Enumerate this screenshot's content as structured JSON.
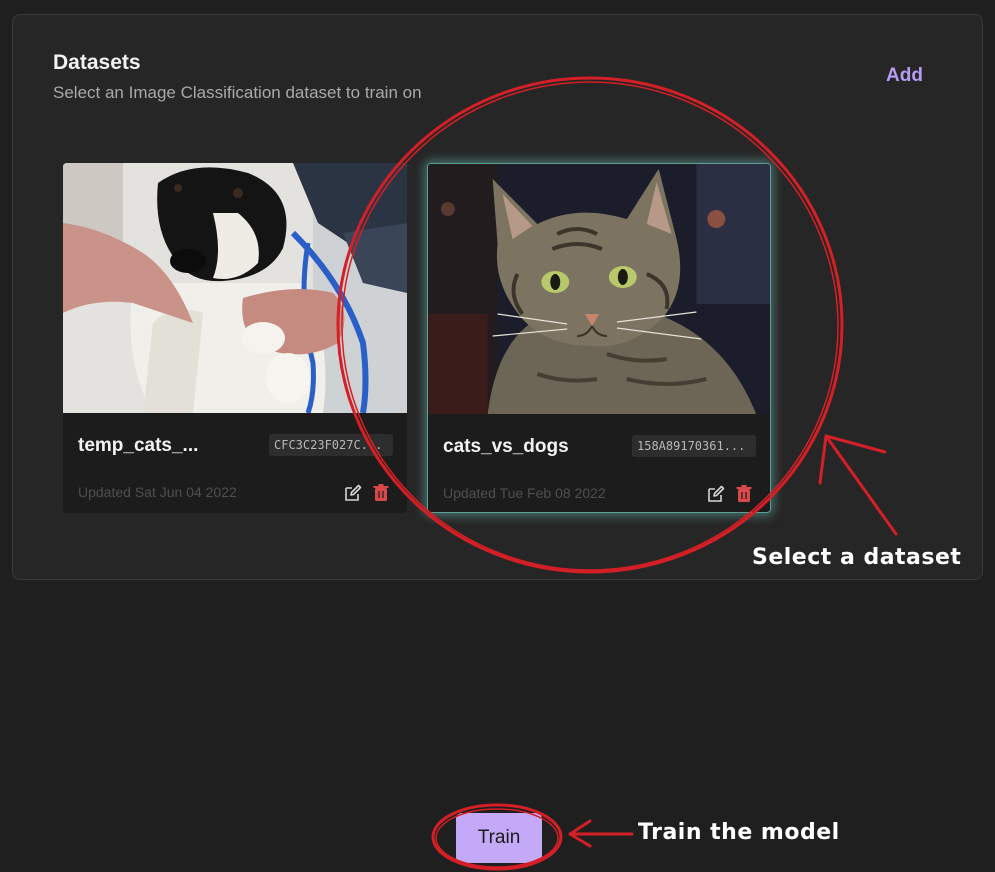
{
  "panel": {
    "title": "Datasets",
    "subtitle": "Select an Image Classification dataset to train on",
    "add_label": "Add"
  },
  "datasets": [
    {
      "name": "temp_cats_...",
      "id": "CFC3C23F027C...",
      "updated": "Updated Sat Jun 04 2022",
      "thumbnail": "dog-photo"
    },
    {
      "name": "cats_vs_dogs",
      "id": "158A89170361...",
      "updated": "Updated Tue Feb 08 2022",
      "thumbnail": "tabby-cat-photo",
      "selected": true
    }
  ],
  "train_label": "Train",
  "annotations": {
    "select": "Select a dataset",
    "train": "Train the model",
    "color": "#d41f26"
  },
  "colors": {
    "accent": "#b69cf4",
    "train_button": "#c3a9f8",
    "delete_icon": "#d9484a",
    "selected_glow": "#5c9e94"
  },
  "icons": [
    "edit-icon",
    "trash-icon"
  ]
}
